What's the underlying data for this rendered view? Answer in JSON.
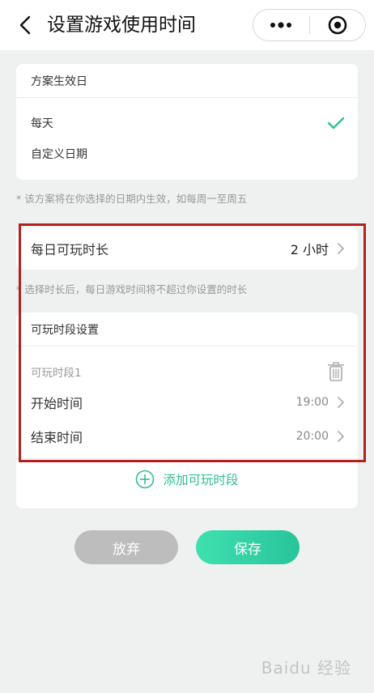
{
  "header": {
    "title": "设置游戏使用时间",
    "menu_dots": "•••"
  },
  "effective": {
    "heading": "方案生效日",
    "options": [
      {
        "label": "每天",
        "selected": true
      },
      {
        "label": "自定义日期",
        "selected": false
      }
    ],
    "note": "* 该方案将在你选择的日期内生效，如每周一至周五"
  },
  "daily": {
    "label": "每日可玩时长",
    "value": "2 小时",
    "note": "* 选择时长后，每日游戏时间将不超过你设置的时长"
  },
  "slots": {
    "heading": "可玩时段设置",
    "slot_title": "可玩时段1",
    "start_label": "开始时间",
    "start_value": "19:00",
    "end_label": "结束时间",
    "end_value": "20:00",
    "add_label": "添加可玩时段"
  },
  "actions": {
    "discard": "放弃",
    "save": "保存"
  },
  "colors": {
    "accent": "#2fbf95",
    "save_gradient_start": "#3fe0b0",
    "save_gradient_end": "#28c49a",
    "discard": "#bdbdbd",
    "highlight_frame": "#b3211f"
  },
  "watermark": "Baidu 经验"
}
